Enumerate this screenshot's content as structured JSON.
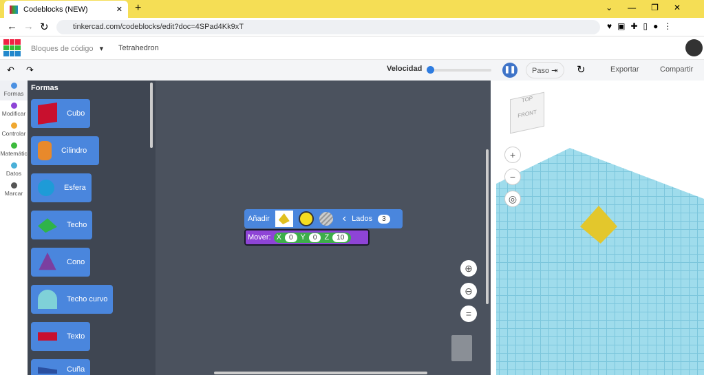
{
  "browser": {
    "tab_title": "Codeblocks (NEW)",
    "url": "tinkercad.com/codeblocks/edit?doc=4SPad4Kk9xT"
  },
  "header": {
    "mode": "Bloques de código",
    "project": "Tetrahedron",
    "logo": "TINKERCAD"
  },
  "toolbar": {
    "speed_label": "Velocidad",
    "speed_value": 0,
    "step": "Paso",
    "export": "Exportar",
    "share": "Compartir"
  },
  "categories": [
    {
      "label": "Formas",
      "color": "#4a90e2"
    },
    {
      "label": "Modificar",
      "color": "#8e44d6"
    },
    {
      "label": "Controlar",
      "color": "#f0a830"
    },
    {
      "label": "Matemátic",
      "color": "#3dbb3d"
    },
    {
      "label": "Datos",
      "color": "#4ab0d8"
    },
    {
      "label": "Marcar",
      "color": "#555555"
    }
  ],
  "palette": {
    "title": "Formas",
    "blocks": [
      {
        "label": "Cubo",
        "color": "#c8102e"
      },
      {
        "label": "Cilindro",
        "color": "#e8892b"
      },
      {
        "label": "Esfera",
        "color": "#1e9bd7"
      },
      {
        "label": "Techo",
        "color": "#2fb34a"
      },
      {
        "label": "Cono",
        "color": "#7b3fa0"
      },
      {
        "label": "Techo curvo",
        "color": "#7fd1d8"
      },
      {
        "label": "Texto",
        "color": "#c8102e"
      },
      {
        "label": "Cuña",
        "color": "#2a4fa0"
      }
    ]
  },
  "script": {
    "add_label": "Añadir",
    "sides_label": "Lados",
    "sides": "3",
    "move_label": "Mover:",
    "x_label": "X",
    "x": "0",
    "y_label": "Y",
    "y": "0",
    "z_label": "Z",
    "z": "10"
  },
  "viewcube": {
    "top": "TOP",
    "front": "FRONT"
  }
}
